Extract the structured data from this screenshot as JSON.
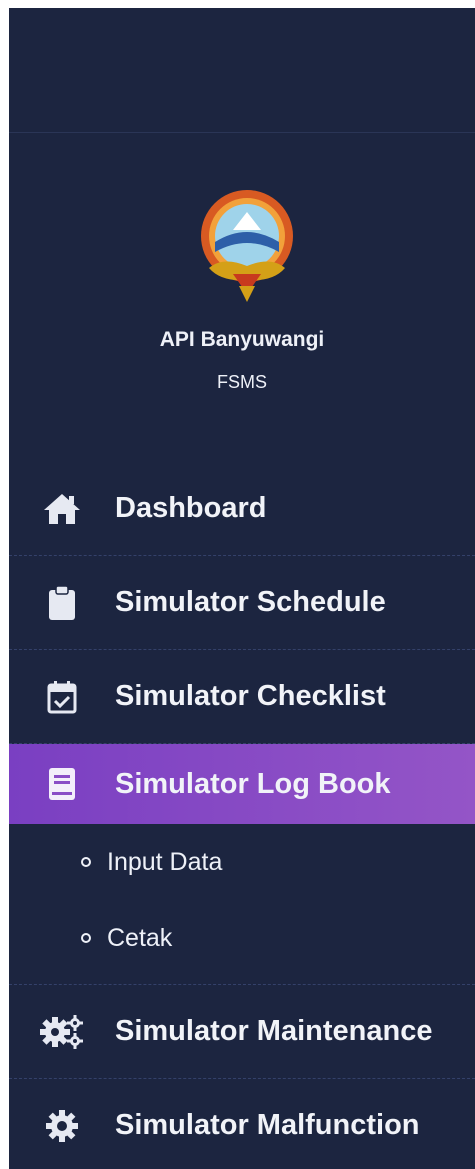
{
  "brand": {
    "name": "API Banyuwangi",
    "subtitle": "FSMS"
  },
  "menu": [
    {
      "label": "Dashboard",
      "icon": "home-icon"
    },
    {
      "label": "Simulator Schedule",
      "icon": "clipboard-icon"
    },
    {
      "label": "Simulator Checklist",
      "icon": "calendar-check-icon"
    },
    {
      "label": "Simulator Log Book",
      "icon": "book-icon",
      "active": true
    },
    {
      "label": "Simulator Maintenance",
      "icon": "cogs-icon"
    },
    {
      "label": "Simulator Malfunction",
      "icon": "gear-icon"
    }
  ],
  "submenu": [
    {
      "label": "Input Data"
    },
    {
      "label": "Cetak"
    }
  ],
  "colors": {
    "sidebar_bg": "#1c2540",
    "active_start": "#7a3fc2",
    "active_end": "#9455c7",
    "text": "#f1f3f8"
  }
}
